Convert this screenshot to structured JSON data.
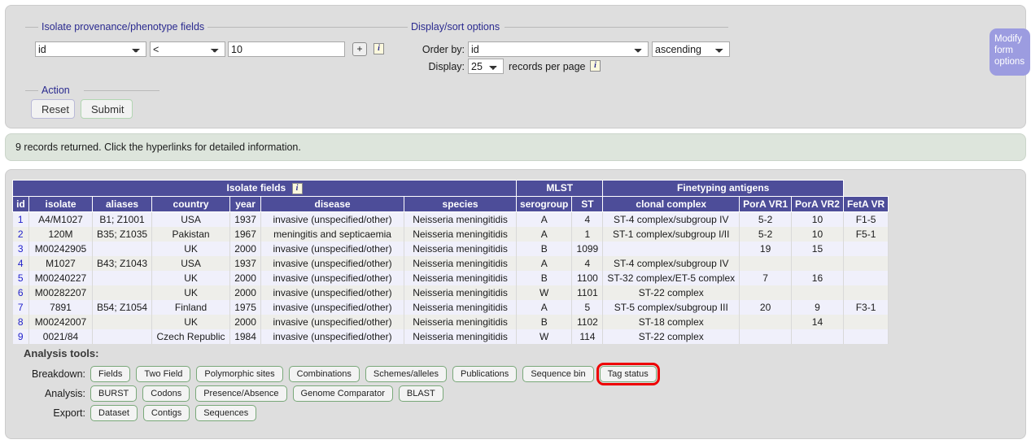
{
  "query_form": {
    "isolate_group": {
      "legend": "Isolate provenance/phenotype fields",
      "field_value": "id",
      "operator_value": "<",
      "term_value": "10",
      "add_button": "+",
      "info_button": "i"
    },
    "display_group": {
      "legend": "Display/sort options",
      "order_by_label": "Order by:",
      "order_by_value": "id",
      "direction_value": "ascending",
      "display_label": "Display:",
      "records_value": "25",
      "records_suffix": "records per page",
      "info_button": "i"
    },
    "action_group": {
      "legend": "Action",
      "reset_label": "Reset",
      "submit_label": "Submit"
    },
    "modify_tab": "Modify form options"
  },
  "message": "9 records returned. Click the hyperlinks for detailed information.",
  "table": {
    "group_headers": [
      {
        "label": "Isolate fields",
        "span": 7,
        "info": "i"
      },
      {
        "label": "MLST",
        "span": 2,
        "info": ""
      },
      {
        "label": "Finetyping antigens",
        "span": 3,
        "info": ""
      }
    ],
    "columns": [
      "id",
      "isolate",
      "aliases",
      "country",
      "year",
      "disease",
      "species",
      "serogroup",
      "ST",
      "clonal complex",
      "PorA VR1",
      "PorA VR2",
      "FetA VR"
    ],
    "rows": [
      {
        "id": "1",
        "isolate": "A4/M1027",
        "aliases": "B1; Z1001",
        "country": "USA",
        "year": "1937",
        "disease": "invasive (unspecified/other)",
        "species": "Neisseria meningitidis",
        "serogroup": "A",
        "st": "4",
        "clonal_complex": "ST-4 complex/subgroup IV",
        "pora_vr1": "5-2",
        "pora_vr2": "10",
        "feta_vr": "F1-5"
      },
      {
        "id": "2",
        "isolate": "120M",
        "aliases": "B35; Z1035",
        "country": "Pakistan",
        "year": "1967",
        "disease": "meningitis and septicaemia",
        "species": "Neisseria meningitidis",
        "serogroup": "A",
        "st": "1",
        "clonal_complex": "ST-1 complex/subgroup I/II",
        "pora_vr1": "5-2",
        "pora_vr2": "10",
        "feta_vr": "F5-1"
      },
      {
        "id": "3",
        "isolate": "M00242905",
        "aliases": "",
        "country": "UK",
        "year": "2000",
        "disease": "invasive (unspecified/other)",
        "species": "Neisseria meningitidis",
        "serogroup": "B",
        "st": "1099",
        "clonal_complex": "",
        "pora_vr1": "19",
        "pora_vr2": "15",
        "feta_vr": ""
      },
      {
        "id": "4",
        "isolate": "M1027",
        "aliases": "B43; Z1043",
        "country": "USA",
        "year": "1937",
        "disease": "invasive (unspecified/other)",
        "species": "Neisseria meningitidis",
        "serogroup": "A",
        "st": "4",
        "clonal_complex": "ST-4 complex/subgroup IV",
        "pora_vr1": "",
        "pora_vr2": "",
        "feta_vr": ""
      },
      {
        "id": "5",
        "isolate": "M00240227",
        "aliases": "",
        "country": "UK",
        "year": "2000",
        "disease": "invasive (unspecified/other)",
        "species": "Neisseria meningitidis",
        "serogroup": "B",
        "st": "1100",
        "clonal_complex": "ST-32 complex/ET-5 complex",
        "pora_vr1": "7",
        "pora_vr2": "16",
        "feta_vr": ""
      },
      {
        "id": "6",
        "isolate": "M00282207",
        "aliases": "",
        "country": "UK",
        "year": "2000",
        "disease": "invasive (unspecified/other)",
        "species": "Neisseria meningitidis",
        "serogroup": "W",
        "st": "1101",
        "clonal_complex": "ST-22 complex",
        "pora_vr1": "",
        "pora_vr2": "",
        "feta_vr": ""
      },
      {
        "id": "7",
        "isolate": "7891",
        "aliases": "B54; Z1054",
        "country": "Finland",
        "year": "1975",
        "disease": "invasive (unspecified/other)",
        "species": "Neisseria meningitidis",
        "serogroup": "A",
        "st": "5",
        "clonal_complex": "ST-5 complex/subgroup III",
        "pora_vr1": "20",
        "pora_vr2": "9",
        "feta_vr": "F3-1"
      },
      {
        "id": "8",
        "isolate": "M00242007",
        "aliases": "",
        "country": "UK",
        "year": "2000",
        "disease": "invasive (unspecified/other)",
        "species": "Neisseria meningitidis",
        "serogroup": "B",
        "st": "1102",
        "clonal_complex": "ST-18 complex",
        "pora_vr1": "",
        "pora_vr2": "14",
        "feta_vr": ""
      },
      {
        "id": "9",
        "isolate": "0021/84",
        "aliases": "",
        "country": "Czech Republic",
        "year": "1984",
        "disease": "invasive (unspecified/other)",
        "species": "Neisseria meningitidis",
        "serogroup": "W",
        "st": "114",
        "clonal_complex": "ST-22 complex",
        "pora_vr1": "",
        "pora_vr2": "",
        "feta_vr": ""
      }
    ]
  },
  "analysis_tools": {
    "title": "Analysis tools:",
    "rows": [
      {
        "label": "Breakdown:",
        "buttons": [
          {
            "label": "Fields",
            "highlight": false
          },
          {
            "label": "Two Field",
            "highlight": false
          },
          {
            "label": "Polymorphic sites",
            "highlight": false
          },
          {
            "label": "Combinations",
            "highlight": false
          },
          {
            "label": "Schemes/alleles",
            "highlight": false
          },
          {
            "label": "Publications",
            "highlight": false
          },
          {
            "label": "Sequence bin",
            "highlight": false
          },
          {
            "label": "Tag status",
            "highlight": true
          }
        ]
      },
      {
        "label": "Analysis:",
        "buttons": [
          {
            "label": "BURST",
            "highlight": false
          },
          {
            "label": "Codons",
            "highlight": false
          },
          {
            "label": "Presence/Absence",
            "highlight": false
          },
          {
            "label": "Genome Comparator",
            "highlight": false
          },
          {
            "label": "BLAST",
            "highlight": false
          }
        ]
      },
      {
        "label": "Export:",
        "buttons": [
          {
            "label": "Dataset",
            "highlight": false
          },
          {
            "label": "Contigs",
            "highlight": false
          },
          {
            "label": "Sequences",
            "highlight": false
          }
        ]
      }
    ]
  },
  "colors": {
    "header_blue": "#4d4d99",
    "highlight_red": "#ee0000",
    "tab_purple": "#9c9ce0",
    "message_green": "#dde5dc"
  }
}
